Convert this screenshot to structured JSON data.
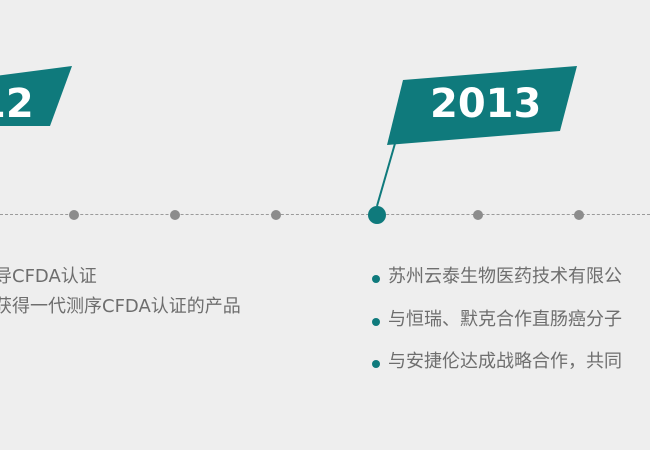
{
  "timeline": {
    "left_event": {
      "year_label": "12",
      "lines": [
        "导CFDA认证",
        "获得一代测序CFDA认证的产品"
      ]
    },
    "right_event": {
      "year_label": "2013",
      "items": [
        "苏州云泰生物医药技术有限公",
        "与恒瑞、默克合作直肠癌分子",
        "与安捷伦达成战略合作，共同"
      ]
    }
  },
  "colors": {
    "accent": "#0f7a7c",
    "background": "#eeeeee",
    "text": "#6e6e6e",
    "dot": "#8c8c8c"
  }
}
